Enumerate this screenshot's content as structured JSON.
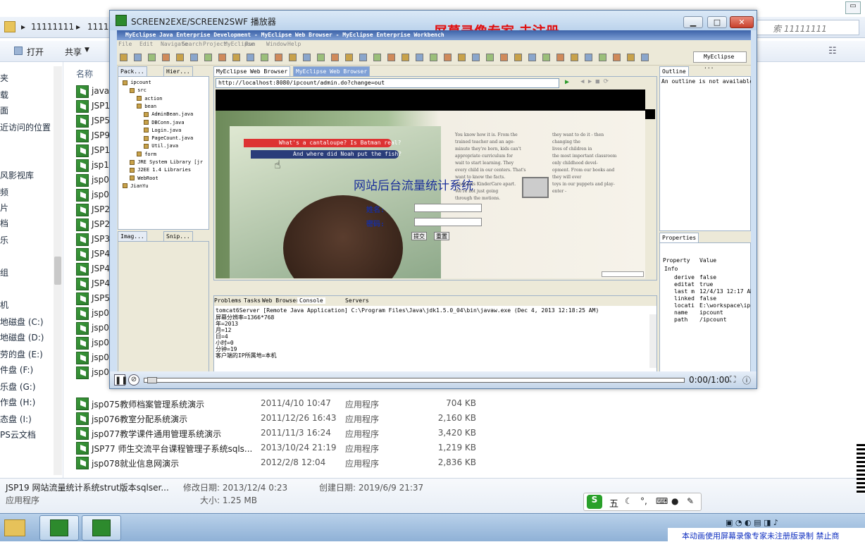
{
  "explorer": {
    "breadcrumb": [
      "11111111",
      "1111"
    ],
    "search_placeholder": "索 11111111",
    "toolbar": {
      "open_label": "打开",
      "share_label": "共享"
    },
    "sidebar_items": [
      "夹",
      "载",
      "面",
      "近访问的位置",
      "风影视库",
      "频",
      "片",
      "档",
      "乐",
      "组",
      "机",
      "地磁盘 (C:)",
      "地磁盘 (D:)",
      "劳的盘 (E:)",
      "件盘 (F:)",
      "乐盘 (G:)",
      "作盘 (H:)",
      "态盘 (I:)",
      "PS云文档"
    ],
    "column_name": "名称",
    "files_partial": [
      "java",
      "JSP1",
      "JSP5",
      "JSP9",
      "JSP1",
      "jsp1",
      "jsp0",
      "jsp0",
      "JSP2",
      "JSP2",
      "JSP3",
      "JSP4",
      "JSP4",
      "JSP4",
      "JSP5",
      "jsp0",
      "jsp0",
      "jsp0",
      "jsp0",
      "jsp0"
    ],
    "files": [
      {
        "name": "jsp075教师档案管理系统演示",
        "date": "2011/4/10 10:47",
        "type": "应用程序",
        "size": "704 KB"
      },
      {
        "name": "jsp076教室分配系统演示",
        "date": "2011/12/26 16:43",
        "type": "应用程序",
        "size": "2,160 KB"
      },
      {
        "name": "jsp077教学课件通用管理系统演示",
        "date": "2011/11/3 16:24",
        "type": "应用程序",
        "size": "3,420 KB"
      },
      {
        "name": "JSP77 师生交流平台课程管理子系统sqls...",
        "date": "2013/10/24 21:19",
        "type": "应用程序",
        "size": "1,219 KB"
      },
      {
        "name": "jsp078就业信息网演示",
        "date": "2012/2/8 12:04",
        "type": "应用程序",
        "size": "2,836 KB"
      }
    ],
    "status": {
      "filename": "JSP19 网站流量统计系统strut版本sqlser...",
      "modified": "修改日期: 2013/12/4 0:23",
      "created": "创建日期: 2019/6/9 21:37",
      "type": "应用程序",
      "size": "大小: 1.25 MB"
    }
  },
  "player": {
    "title": "SCREEN2EXE/SCREEN2SWF 播放器",
    "watermark": "屏幕录像专家  未注册",
    "time": "0:00/1:00",
    "eclipse_title": "MyEclipse Java Enterprise Development - MyEclipse Web Browser - MyEclipse Enterprise Workbench",
    "menu": [
      "File",
      "Edit",
      "Navigate",
      "Search",
      "Project",
      "MyEclipse",
      "Run",
      "Window",
      "Help"
    ],
    "perspective": "MyEclipse ...",
    "left_tabs": [
      "Pack...",
      "Hier..."
    ],
    "tree": [
      "ipcount",
      "src",
      "action",
      "bean",
      "AdminBean.java",
      "DBConn.java",
      "Login.java",
      "PageCount.java",
      "Util.java",
      "form",
      "JRE System Library [jr",
      "J2EE 1.4 Libraries",
      "WebRoot",
      "JianYu"
    ],
    "bottom_left_tabs": [
      "Imag...",
      "Snip..."
    ],
    "editor_tabs": [
      "MyEclipse Web Browser",
      "MyEclipse Web Browser"
    ],
    "url": "http://localhost:8080/ipcount/admin.do?change=out",
    "page": {
      "headline": "网站后台流量统计系统",
      "pencil1": "What's a cantaloupe? Is Batman real?",
      "pencil2": "And where did Noah put the fish?",
      "user_label": "姓名:",
      "pass_label": "密码:",
      "submit": "提交",
      "reset": "重置",
      "book_text": [
        "You know how it is. From the",
        "trained teacher and an age-",
        "minute they're born, kids can't",
        "appropriate curriculum for",
        "wait to start learning. They",
        "every child in our centers. That's",
        "want to know the facts.",
        "what sets KinderCare apart.",
        "We're not just going",
        "through the motions.",
        "they want to do it - then",
        "changing the",
        "lives of children in",
        "the most important classroom",
        "only childhood devel-",
        "opment. From our books and",
        "they will ever",
        "toys in our puppets and play-",
        "enter -"
      ]
    },
    "outline": {
      "tab": "Outline",
      "text": "An outline is not available."
    },
    "properties": {
      "tab": "Properties",
      "headers": [
        "Property",
        "Value"
      ],
      "group": "Info",
      "rows": [
        [
          "derive",
          "false"
        ],
        [
          "editat",
          "true"
        ],
        [
          "last m",
          "12/4/13 12:17 AM"
        ],
        [
          "linked",
          "false"
        ],
        [
          "locati",
          "E:\\workspace\\ip..."
        ],
        [
          "name",
          "ipcount"
        ],
        [
          "path",
          "/ipcount"
        ]
      ]
    },
    "console": {
      "tabs": [
        "Problems",
        "Tasks",
        "Web Browser",
        "Console",
        "Servers"
      ],
      "header": "tomcat6Server [Remote Java Application] C:\\Program Files\\Java\\jdk1.5.0_04\\bin\\javaw.exe (Dec 4, 2013 12:18:25 AM)",
      "lines": [
        "屏幕分辨率=1366*768",
        "年=2013",
        "月=12",
        "日=4",
        "小时=0",
        "分钟=19",
        "客户端的IP所属地=本机"
      ]
    }
  },
  "ime": {
    "label": "五"
  },
  "tray": {
    "notice": "本动画使用屏幕录像专家未注册版录制  禁止商"
  },
  "colors": {
    "accent": "#2a7ccf",
    "watermark": "#e01010",
    "headline": "#1a2f9a",
    "green": "#2d8a2d"
  }
}
